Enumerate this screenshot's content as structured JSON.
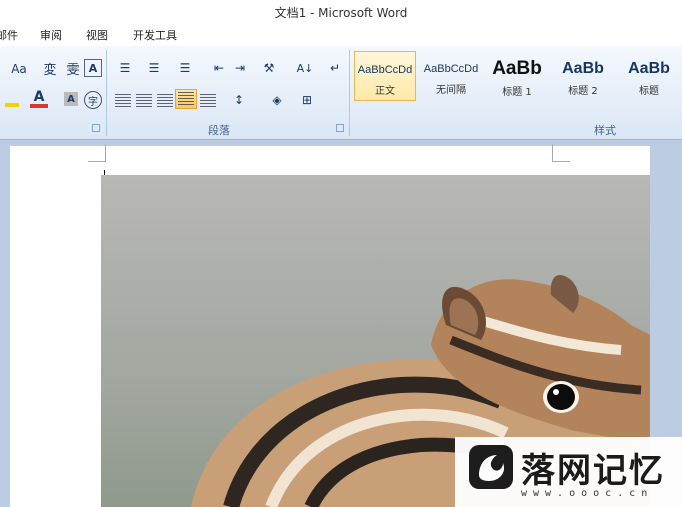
{
  "window": {
    "title": "文档1 - Microsoft Word"
  },
  "tabs": [
    "邮件",
    "审阅",
    "视图",
    "开发工具"
  ],
  "ribbon": {
    "font_group": {
      "change_case": "Aa"
    },
    "paragraph_group": {
      "label": "段落"
    },
    "styles_group": {
      "label": "样式",
      "tiles": [
        {
          "sample": "AaBbCcDd",
          "name": "正文",
          "selected": true
        },
        {
          "sample": "AaBbCcDd",
          "name": "无间隔",
          "selected": false
        },
        {
          "sample": "AaBb",
          "name": "标题 1",
          "selected": false
        },
        {
          "sample": "AaBb",
          "name": "标题 2",
          "selected": false
        },
        {
          "sample": "AaBb",
          "name": "标题",
          "selected": false
        }
      ]
    },
    "colors": {
      "font_color": "#d63a2f",
      "highlight": "#f5d000",
      "accent": "#e5b85a"
    }
  },
  "document": {
    "image_subject": "chipmunk"
  },
  "watermark": {
    "text": "落网记忆",
    "url": "www.oooc.cn"
  }
}
